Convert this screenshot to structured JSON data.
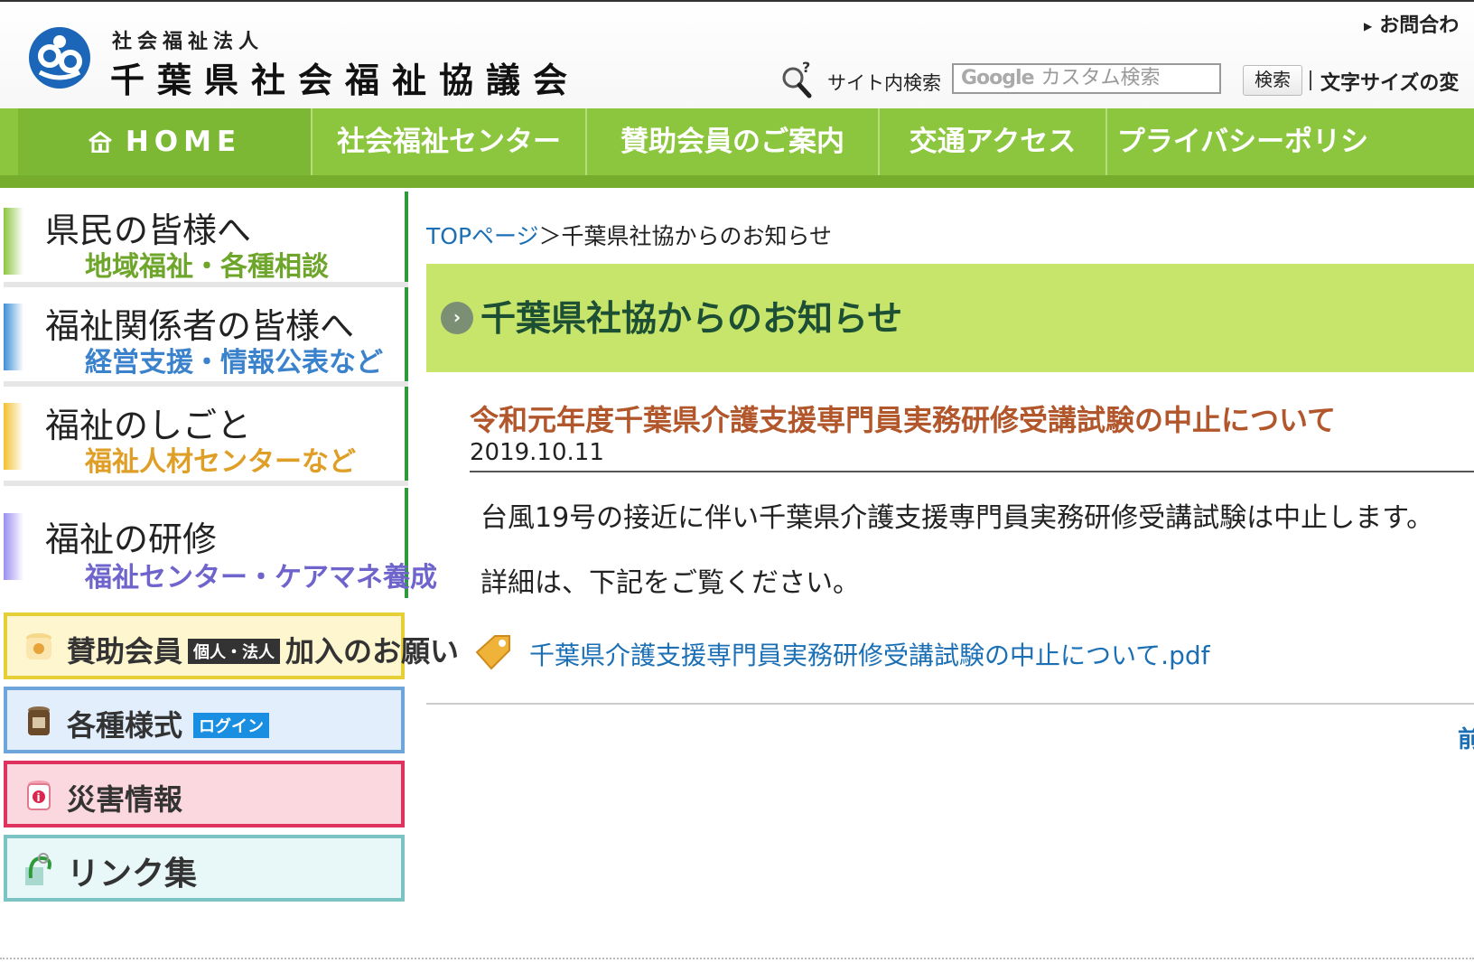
{
  "header": {
    "org_sub": "社会福祉法人",
    "org_name": "千葉県社会福祉協議会",
    "contact": "お問合わ",
    "search_label": "サイト内検索",
    "search_brand": "Google",
    "search_placeholder": "カスタム検索",
    "search_button": "検索",
    "font_size_label": "文字サイズの変"
  },
  "nav": {
    "items": [
      {
        "label": "HOME",
        "icon": "home-icon"
      },
      {
        "label": "社会福祉センター"
      },
      {
        "label": "賛助会員のご案内"
      },
      {
        "label": "交通アクセス"
      },
      {
        "label": "プライバシーポリシー"
      }
    ]
  },
  "sidebar": {
    "categories": [
      {
        "title": "県民の皆様へ",
        "sub": "地域福祉・各種相談",
        "color": "#8cc63f"
      },
      {
        "title": "福祉関係者の皆様へ",
        "sub": "経営支援・情報公表など",
        "color": "#3f8fd8"
      },
      {
        "title": "福祉のしごと",
        "sub": "福祉人材センターなど",
        "color": "#e1a32a"
      },
      {
        "title": "福祉の研修",
        "sub": "福祉センター・ケアマネ養成",
        "color": "#7b6fd8"
      }
    ],
    "banners": [
      {
        "label": "賛助会員",
        "badge": "個人・法人",
        "suffix": "加入のお願い",
        "icon": "donation-pot-icon"
      },
      {
        "label": "各種様式",
        "badge": "ログイン",
        "icon": "form-jar-icon"
      },
      {
        "label": "災害情報",
        "icon": "info-jar-icon"
      },
      {
        "label": "リンク集",
        "icon": "link-clip-icon"
      }
    ]
  },
  "breadcrumb": {
    "top": "TOPページ",
    "separator": "＞",
    "current": "千葉県社協からのお知らせ"
  },
  "main": {
    "heading": "千葉県社協からのお知らせ",
    "article_title": "令和元年度千葉県介護支援専門員実務研修受講試験の中止について",
    "article_date": "2019.10.11",
    "paragraph1": "台風19号の接近に伴い千葉県介護支援専門員実務研修受講試験は中止します。",
    "paragraph2": "詳細は、下記をご覧ください。",
    "pdf_link": "千葉県介護支援専門員実務研修受講試験の中止について.pdf",
    "prev_link": "前"
  }
}
